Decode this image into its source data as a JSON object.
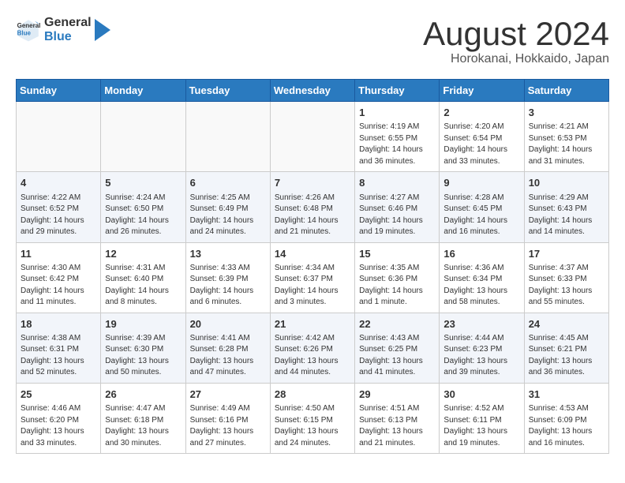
{
  "header": {
    "logo_general": "General",
    "logo_blue": "Blue",
    "title": "August 2024",
    "subtitle": "Horokanai, Hokkaido, Japan"
  },
  "days_of_week": [
    "Sunday",
    "Monday",
    "Tuesday",
    "Wednesday",
    "Thursday",
    "Friday",
    "Saturday"
  ],
  "weeks": [
    [
      {
        "day": "",
        "info": ""
      },
      {
        "day": "",
        "info": ""
      },
      {
        "day": "",
        "info": ""
      },
      {
        "day": "",
        "info": ""
      },
      {
        "day": "1",
        "info": "Sunrise: 4:19 AM\nSunset: 6:55 PM\nDaylight: 14 hours and 36 minutes."
      },
      {
        "day": "2",
        "info": "Sunrise: 4:20 AM\nSunset: 6:54 PM\nDaylight: 14 hours and 33 minutes."
      },
      {
        "day": "3",
        "info": "Sunrise: 4:21 AM\nSunset: 6:53 PM\nDaylight: 14 hours and 31 minutes."
      }
    ],
    [
      {
        "day": "4",
        "info": "Sunrise: 4:22 AM\nSunset: 6:52 PM\nDaylight: 14 hours and 29 minutes."
      },
      {
        "day": "5",
        "info": "Sunrise: 4:24 AM\nSunset: 6:50 PM\nDaylight: 14 hours and 26 minutes."
      },
      {
        "day": "6",
        "info": "Sunrise: 4:25 AM\nSunset: 6:49 PM\nDaylight: 14 hours and 24 minutes."
      },
      {
        "day": "7",
        "info": "Sunrise: 4:26 AM\nSunset: 6:48 PM\nDaylight: 14 hours and 21 minutes."
      },
      {
        "day": "8",
        "info": "Sunrise: 4:27 AM\nSunset: 6:46 PM\nDaylight: 14 hours and 19 minutes."
      },
      {
        "day": "9",
        "info": "Sunrise: 4:28 AM\nSunset: 6:45 PM\nDaylight: 14 hours and 16 minutes."
      },
      {
        "day": "10",
        "info": "Sunrise: 4:29 AM\nSunset: 6:43 PM\nDaylight: 14 hours and 14 minutes."
      }
    ],
    [
      {
        "day": "11",
        "info": "Sunrise: 4:30 AM\nSunset: 6:42 PM\nDaylight: 14 hours and 11 minutes."
      },
      {
        "day": "12",
        "info": "Sunrise: 4:31 AM\nSunset: 6:40 PM\nDaylight: 14 hours and 8 minutes."
      },
      {
        "day": "13",
        "info": "Sunrise: 4:33 AM\nSunset: 6:39 PM\nDaylight: 14 hours and 6 minutes."
      },
      {
        "day": "14",
        "info": "Sunrise: 4:34 AM\nSunset: 6:37 PM\nDaylight: 14 hours and 3 minutes."
      },
      {
        "day": "15",
        "info": "Sunrise: 4:35 AM\nSunset: 6:36 PM\nDaylight: 14 hours and 1 minute."
      },
      {
        "day": "16",
        "info": "Sunrise: 4:36 AM\nSunset: 6:34 PM\nDaylight: 13 hours and 58 minutes."
      },
      {
        "day": "17",
        "info": "Sunrise: 4:37 AM\nSunset: 6:33 PM\nDaylight: 13 hours and 55 minutes."
      }
    ],
    [
      {
        "day": "18",
        "info": "Sunrise: 4:38 AM\nSunset: 6:31 PM\nDaylight: 13 hours and 52 minutes."
      },
      {
        "day": "19",
        "info": "Sunrise: 4:39 AM\nSunset: 6:30 PM\nDaylight: 13 hours and 50 minutes."
      },
      {
        "day": "20",
        "info": "Sunrise: 4:41 AM\nSunset: 6:28 PM\nDaylight: 13 hours and 47 minutes."
      },
      {
        "day": "21",
        "info": "Sunrise: 4:42 AM\nSunset: 6:26 PM\nDaylight: 13 hours and 44 minutes."
      },
      {
        "day": "22",
        "info": "Sunrise: 4:43 AM\nSunset: 6:25 PM\nDaylight: 13 hours and 41 minutes."
      },
      {
        "day": "23",
        "info": "Sunrise: 4:44 AM\nSunset: 6:23 PM\nDaylight: 13 hours and 39 minutes."
      },
      {
        "day": "24",
        "info": "Sunrise: 4:45 AM\nSunset: 6:21 PM\nDaylight: 13 hours and 36 minutes."
      }
    ],
    [
      {
        "day": "25",
        "info": "Sunrise: 4:46 AM\nSunset: 6:20 PM\nDaylight: 13 hours and 33 minutes."
      },
      {
        "day": "26",
        "info": "Sunrise: 4:47 AM\nSunset: 6:18 PM\nDaylight: 13 hours and 30 minutes."
      },
      {
        "day": "27",
        "info": "Sunrise: 4:49 AM\nSunset: 6:16 PM\nDaylight: 13 hours and 27 minutes."
      },
      {
        "day": "28",
        "info": "Sunrise: 4:50 AM\nSunset: 6:15 PM\nDaylight: 13 hours and 24 minutes."
      },
      {
        "day": "29",
        "info": "Sunrise: 4:51 AM\nSunset: 6:13 PM\nDaylight: 13 hours and 21 minutes."
      },
      {
        "day": "30",
        "info": "Sunrise: 4:52 AM\nSunset: 6:11 PM\nDaylight: 13 hours and 19 minutes."
      },
      {
        "day": "31",
        "info": "Sunrise: 4:53 AM\nSunset: 6:09 PM\nDaylight: 13 hours and 16 minutes."
      }
    ]
  ]
}
